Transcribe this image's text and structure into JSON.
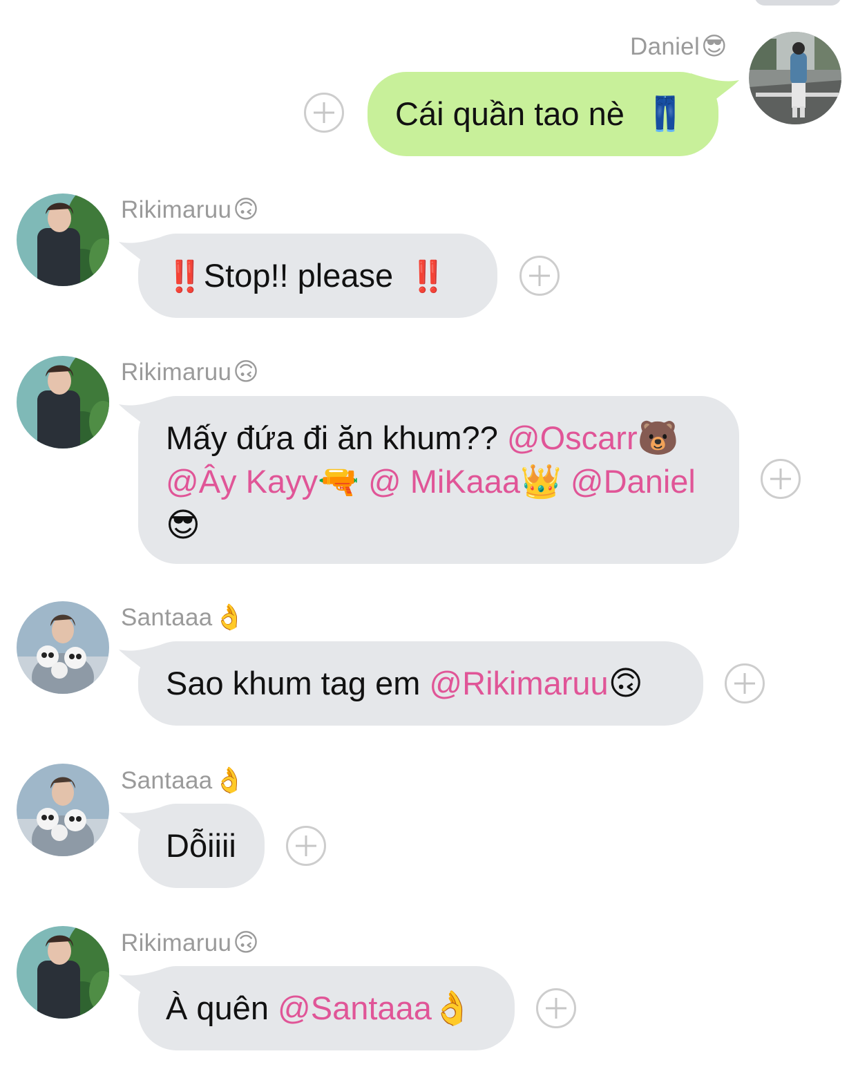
{
  "messages": [
    {
      "sender": "Daniel",
      "sender_emoji": "😎",
      "direction": "outgoing",
      "text": "Cái quần tao nè",
      "emoji": "👖"
    },
    {
      "sender": "Rikimaruu",
      "sender_emoji": "🙃",
      "direction": "incoming",
      "emoji_before": "‼️",
      "text": "Stop!! please",
      "emoji_after": "‼️"
    },
    {
      "sender": "Rikimaruu",
      "sender_emoji": "🙃",
      "direction": "incoming",
      "text_prefix": "Mấy đứa đi ăn khum?? ",
      "mentions": [
        {
          "name": "@Oscarr",
          "emoji": "🐻"
        },
        {
          "name": "@Ây Kayy",
          "emoji": "🔫"
        },
        {
          "name": "@ MiKaaa",
          "emoji": "👑"
        },
        {
          "name": "@Daniel",
          "emoji": "😎"
        }
      ]
    },
    {
      "sender": "Santaaa",
      "sender_emoji": "👌",
      "direction": "incoming",
      "text_prefix": "Sao khum tag em ",
      "mention": "@Rikimaruu",
      "mention_emoji": "🙃"
    },
    {
      "sender": "Santaaa",
      "sender_emoji": "👌",
      "direction": "incoming",
      "text": "Dỗiiii"
    },
    {
      "sender": "Rikimaruu",
      "sender_emoji": "🙃",
      "direction": "incoming",
      "text_prefix": "À quên ",
      "mention": "@Santaaa",
      "mention_emoji": "👌"
    }
  ],
  "colors": {
    "incoming_bubble": "#e5e7ea",
    "outgoing_bubble": "#c8f09a",
    "mention": "#e05597",
    "sender_name": "#9a9a9a"
  },
  "icons": {
    "add_reaction": "plus-circle-icon"
  }
}
